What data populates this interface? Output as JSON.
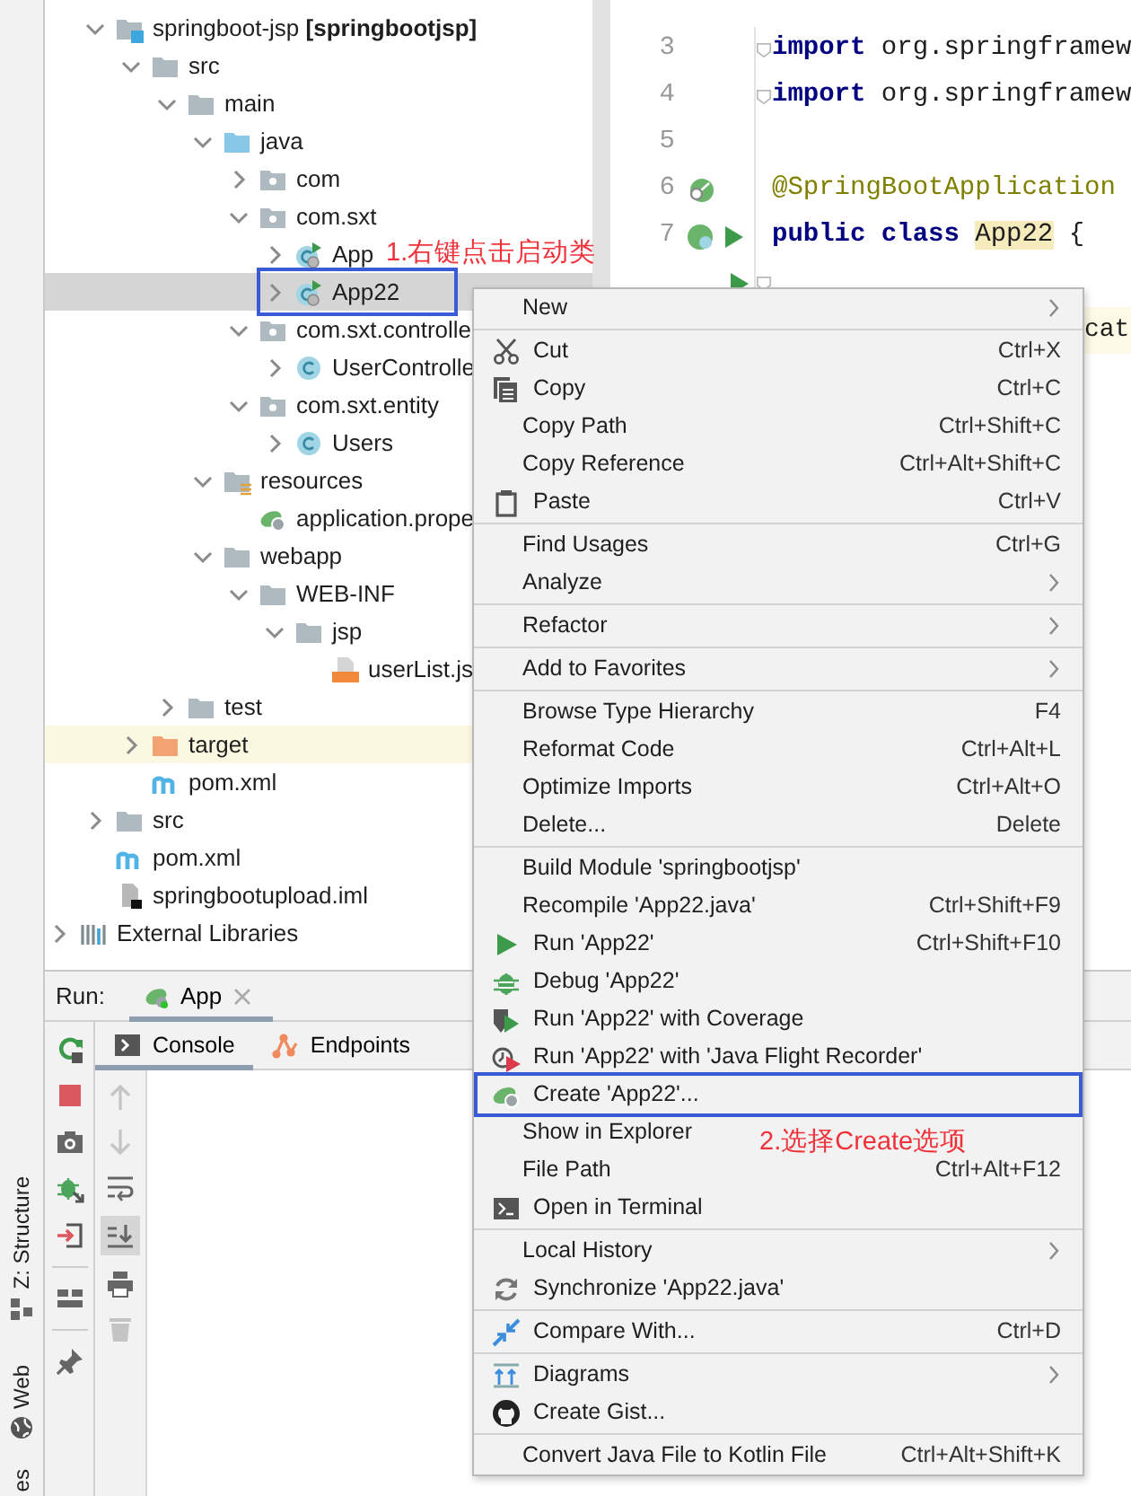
{
  "side_tabs": [
    {
      "label": "Z: Structure"
    },
    {
      "label": "Web"
    },
    {
      "label": "es"
    }
  ],
  "project_tree": {
    "nodes": [
      {
        "label": "springboot-jsp **[springbootjsp]**",
        "kind": "module",
        "expanded": true,
        "selected": false,
        "children": [
          {
            "label": "src",
            "kind": "folder",
            "expanded": true,
            "selected": false,
            "children": [
              {
                "label": "main",
                "kind": "folder",
                "expanded": true,
                "selected": false,
                "children": [
                  {
                    "label": "java",
                    "kind": "source-folder",
                    "expanded": true,
                    "selected": false,
                    "children": [
                      {
                        "label": "com",
                        "kind": "package",
                        "expanded": false,
                        "selected": false
                      },
                      {
                        "label": "com.sxt",
                        "kind": "package",
                        "expanded": true,
                        "selected": false,
                        "children": [
                          {
                            "label": "App",
                            "kind": "spring-class",
                            "expanded": false,
                            "selected": false
                          },
                          {
                            "label": "App22",
                            "kind": "spring-class",
                            "expanded": false,
                            "selected": true,
                            "boxed": true
                          }
                        ]
                      },
                      {
                        "label": "com.sxt.controlle",
                        "kind": "package",
                        "expanded": true,
                        "selected": false,
                        "children": [
                          {
                            "label": "UserControlle",
                            "kind": "class",
                            "expanded": false,
                            "selected": false
                          }
                        ]
                      },
                      {
                        "label": "com.sxt.entity",
                        "kind": "package",
                        "expanded": true,
                        "selected": false,
                        "children": [
                          {
                            "label": "Users",
                            "kind": "class",
                            "expanded": false,
                            "selected": false
                          }
                        ]
                      }
                    ]
                  },
                  {
                    "label": "resources",
                    "kind": "resources-folder",
                    "expanded": true,
                    "selected": false,
                    "children": [
                      {
                        "label": "application.prope",
                        "kind": "spring-properties",
                        "selected": false
                      }
                    ]
                  },
                  {
                    "label": "webapp",
                    "kind": "folder",
                    "expanded": true,
                    "selected": false,
                    "children": [
                      {
                        "label": "WEB-INF",
                        "kind": "folder",
                        "expanded": true,
                        "selected": false,
                        "children": [
                          {
                            "label": "jsp",
                            "kind": "folder",
                            "expanded": true,
                            "selected": false,
                            "children": [
                              {
                                "label": "userList.js",
                                "kind": "jsp",
                                "selected": false
                              }
                            ]
                          }
                        ]
                      }
                    ]
                  }
                ]
              },
              {
                "label": "test",
                "kind": "folder",
                "expanded": false,
                "selected": false
              }
            ]
          },
          {
            "label": "target",
            "kind": "excluded-folder",
            "expanded": false,
            "selected": false,
            "ignored": true
          },
          {
            "label": "pom.xml",
            "kind": "maven",
            "selected": false
          }
        ]
      },
      {
        "label": "src",
        "kind": "folder",
        "expanded": false,
        "selected": false
      },
      {
        "label": "pom.xml",
        "kind": "maven",
        "selected": false
      },
      {
        "label": "springbootupload.iml",
        "kind": "iml",
        "selected": false
      }
    ],
    "root_nodes": [
      {
        "label": "External Libraries",
        "kind": "libraries",
        "expanded": false,
        "selected": false
      }
    ]
  },
  "editor": {
    "lines": [
      {
        "number": "3",
        "fold": true,
        "segments": [
          {
            "text": "import",
            "kind": "keyword"
          },
          {
            "text": " org.springframew",
            "kind": "plain"
          }
        ]
      },
      {
        "number": "4",
        "fold": true,
        "segments": [
          {
            "text": "import",
            "kind": "keyword"
          },
          {
            "text": " org.springframew",
            "kind": "plain"
          }
        ]
      },
      {
        "number": "5"
      },
      {
        "number": "6",
        "kind": "bean",
        "segments": [
          {
            "text": "@SpringBootApplication",
            "kind": "annotation"
          }
        ]
      },
      {
        "number": "7",
        "kind": "bean-run",
        "segments": [
          {
            "text": "public class ",
            "kind": "keyword"
          },
          {
            "text": "App22",
            "kind": "highlight"
          },
          {
            "text": " {",
            "kind": "plain"
          }
        ]
      },
      {
        "kind": "run",
        "fold": true
      },
      {
        "current": true,
        "segments": [
          {
            "text": "cat",
            "kind": "plain"
          }
        ]
      }
    ]
  },
  "run_panel": {
    "title": "Run:",
    "tabs": [
      {
        "label": "App",
        "selected": true
      }
    ],
    "toolbar": [
      {
        "kind": "rerun"
      },
      {
        "kind": "stop"
      },
      {
        "kind": "camera"
      },
      {
        "kind": "debug"
      },
      {
        "kind": "exit"
      },
      {
        "kind": "separator"
      },
      {
        "kind": "layout"
      },
      {
        "kind": "separator"
      },
      {
        "kind": "pin"
      }
    ],
    "console_tabs": [
      {
        "label": "Console",
        "kind": "console",
        "selected": true
      },
      {
        "label": "Endpoints",
        "kind": "endpoints",
        "selected": false
      }
    ],
    "console_toolbar": [
      {
        "kind": "up",
        "disabled": true
      },
      {
        "kind": "down",
        "disabled": true
      },
      {
        "kind": "wrap",
        "disabled": false
      },
      {
        "kind": "scroll-end",
        "disabled": false,
        "on": true
      },
      {
        "kind": "print",
        "disabled": false
      },
      {
        "kind": "trash",
        "disabled": true
      }
    ]
  },
  "context_menu": {
    "groups": [
      [
        {
          "label": "New",
          "submenu": true
        }
      ],
      [
        {
          "label": "Cut",
          "shortcut": "Ctrl+X",
          "kind": "cut"
        },
        {
          "label": "Copy",
          "shortcut": "Ctrl+C",
          "kind": "copy"
        },
        {
          "label": "Copy Path",
          "shortcut": "Ctrl+Shift+C"
        },
        {
          "label": "Copy Reference",
          "shortcut": "Ctrl+Alt+Shift+C"
        },
        {
          "label": "Paste",
          "shortcut": "Ctrl+V",
          "kind": "paste"
        }
      ],
      [
        {
          "label": "Find Usages",
          "shortcut": "Ctrl+G"
        },
        {
          "label": "Analyze",
          "submenu": true
        }
      ],
      [
        {
          "label": "Refactor",
          "submenu": true
        }
      ],
      [
        {
          "label": "Add to Favorites",
          "submenu": true
        }
      ],
      [
        {
          "label": "Browse Type Hierarchy",
          "shortcut": "F4"
        },
        {
          "label": "Reformat Code",
          "shortcut": "Ctrl+Alt+L"
        },
        {
          "label": "Optimize Imports",
          "shortcut": "Ctrl+Alt+O"
        },
        {
          "label": "Delete...",
          "shortcut": "Delete"
        }
      ],
      [
        {
          "label": "Build Module 'springbootjsp'"
        },
        {
          "label": "Recompile 'App22.java'",
          "shortcut": "Ctrl+Shift+F9"
        },
        {
          "label": "Run 'App22'",
          "shortcut": "Ctrl+Shift+F10",
          "kind": "run"
        },
        {
          "label": "Debug 'App22'",
          "kind": "debug"
        },
        {
          "label": "Run 'App22' with Coverage",
          "kind": "coverage"
        },
        {
          "label": "Run 'App22' with 'Java Flight Recorder'",
          "kind": "recorder"
        },
        {
          "label": "Create 'App22'...",
          "kind": "spring",
          "boxed": true
        },
        {
          "label": "Show in Explorer"
        },
        {
          "label": "File Path",
          "shortcut": "Ctrl+Alt+F12"
        },
        {
          "label": "Open in Terminal",
          "kind": "terminal"
        }
      ],
      [
        {
          "label": "Local History",
          "submenu": true
        },
        {
          "label": "Synchronize 'App22.java'",
          "kind": "sync"
        }
      ],
      [
        {
          "label": "Compare With...",
          "shortcut": "Ctrl+D",
          "kind": "compare"
        }
      ],
      [
        {
          "label": "Diagrams",
          "submenu": true,
          "kind": "diagram"
        },
        {
          "label": "Create Gist...",
          "kind": "gist"
        }
      ],
      [
        {
          "label": "Convert Java File to Kotlin File",
          "shortcut": "Ctrl+Alt+Shift+K"
        }
      ]
    ]
  },
  "annotations": [
    {
      "text": "1.右键点击启动类"
    },
    {
      "text": "2.选择Create选项"
    }
  ]
}
